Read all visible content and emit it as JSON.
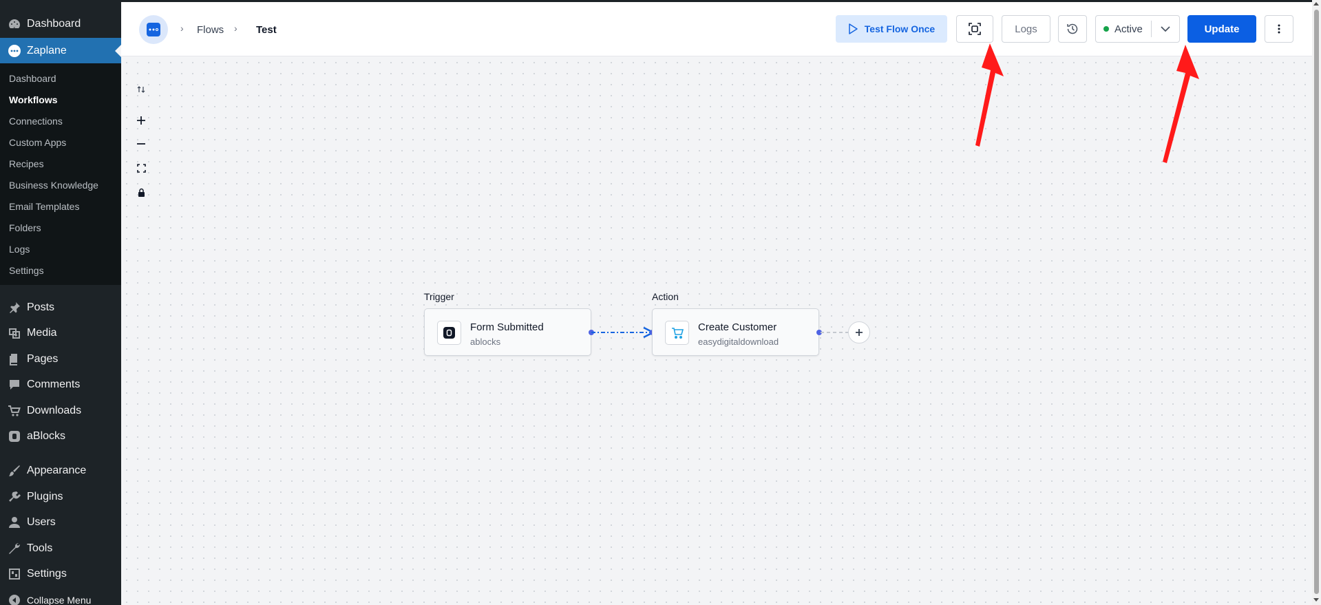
{
  "sidebar": {
    "top_item": {
      "label": "Dashboard",
      "icon": "dashboard-icon"
    },
    "current_plugin": {
      "label": "Zaplane",
      "icon": "zaplane-icon"
    },
    "submenu": [
      {
        "label": "Dashboard",
        "active": false
      },
      {
        "label": "Workflows",
        "active": true
      },
      {
        "label": "Connections",
        "active": false
      },
      {
        "label": "Custom Apps",
        "active": false
      },
      {
        "label": "Recipes",
        "active": false
      },
      {
        "label": "Business Knowledge",
        "active": false
      },
      {
        "label": "Email Templates",
        "active": false
      },
      {
        "label": "Folders",
        "active": false
      },
      {
        "label": "Logs",
        "active": false
      },
      {
        "label": "Settings",
        "active": false
      }
    ],
    "items": [
      {
        "label": "Posts",
        "icon": "pin-icon"
      },
      {
        "label": "Media",
        "icon": "media-icon"
      },
      {
        "label": "Pages",
        "icon": "pages-icon"
      },
      {
        "label": "Comments",
        "icon": "comment-icon"
      },
      {
        "label": "Downloads",
        "icon": "cart-icon"
      },
      {
        "label": "aBlocks",
        "icon": "ablocks-icon"
      },
      {
        "label": "Appearance",
        "icon": "brush-icon"
      },
      {
        "label": "Plugins",
        "icon": "plugin-icon"
      },
      {
        "label": "Users",
        "icon": "user-icon"
      },
      {
        "label": "Tools",
        "icon": "wrench-icon"
      },
      {
        "label": "Settings",
        "icon": "settings-icon"
      },
      {
        "label": "Collapse Menu",
        "icon": "collapse-icon"
      }
    ]
  },
  "header": {
    "breadcrumb": [
      "Flows",
      "Test"
    ],
    "test_flow_label": "Test Flow Once",
    "logs_label": "Logs",
    "status_label": "Active",
    "status_color": "#16a34a",
    "update_label": "Update",
    "accent": "#0b5fe3"
  },
  "canvas": {
    "controls": [
      "sort-icon",
      "zoom-in-icon",
      "zoom-out-icon",
      "fit-view-icon",
      "lock-icon"
    ],
    "trigger": {
      "section_label": "Trigger",
      "title": "Form Submitted",
      "app": "ablocks"
    },
    "action": {
      "section_label": "Action",
      "title": "Create Customer",
      "app": "easydigitaldownload"
    }
  }
}
